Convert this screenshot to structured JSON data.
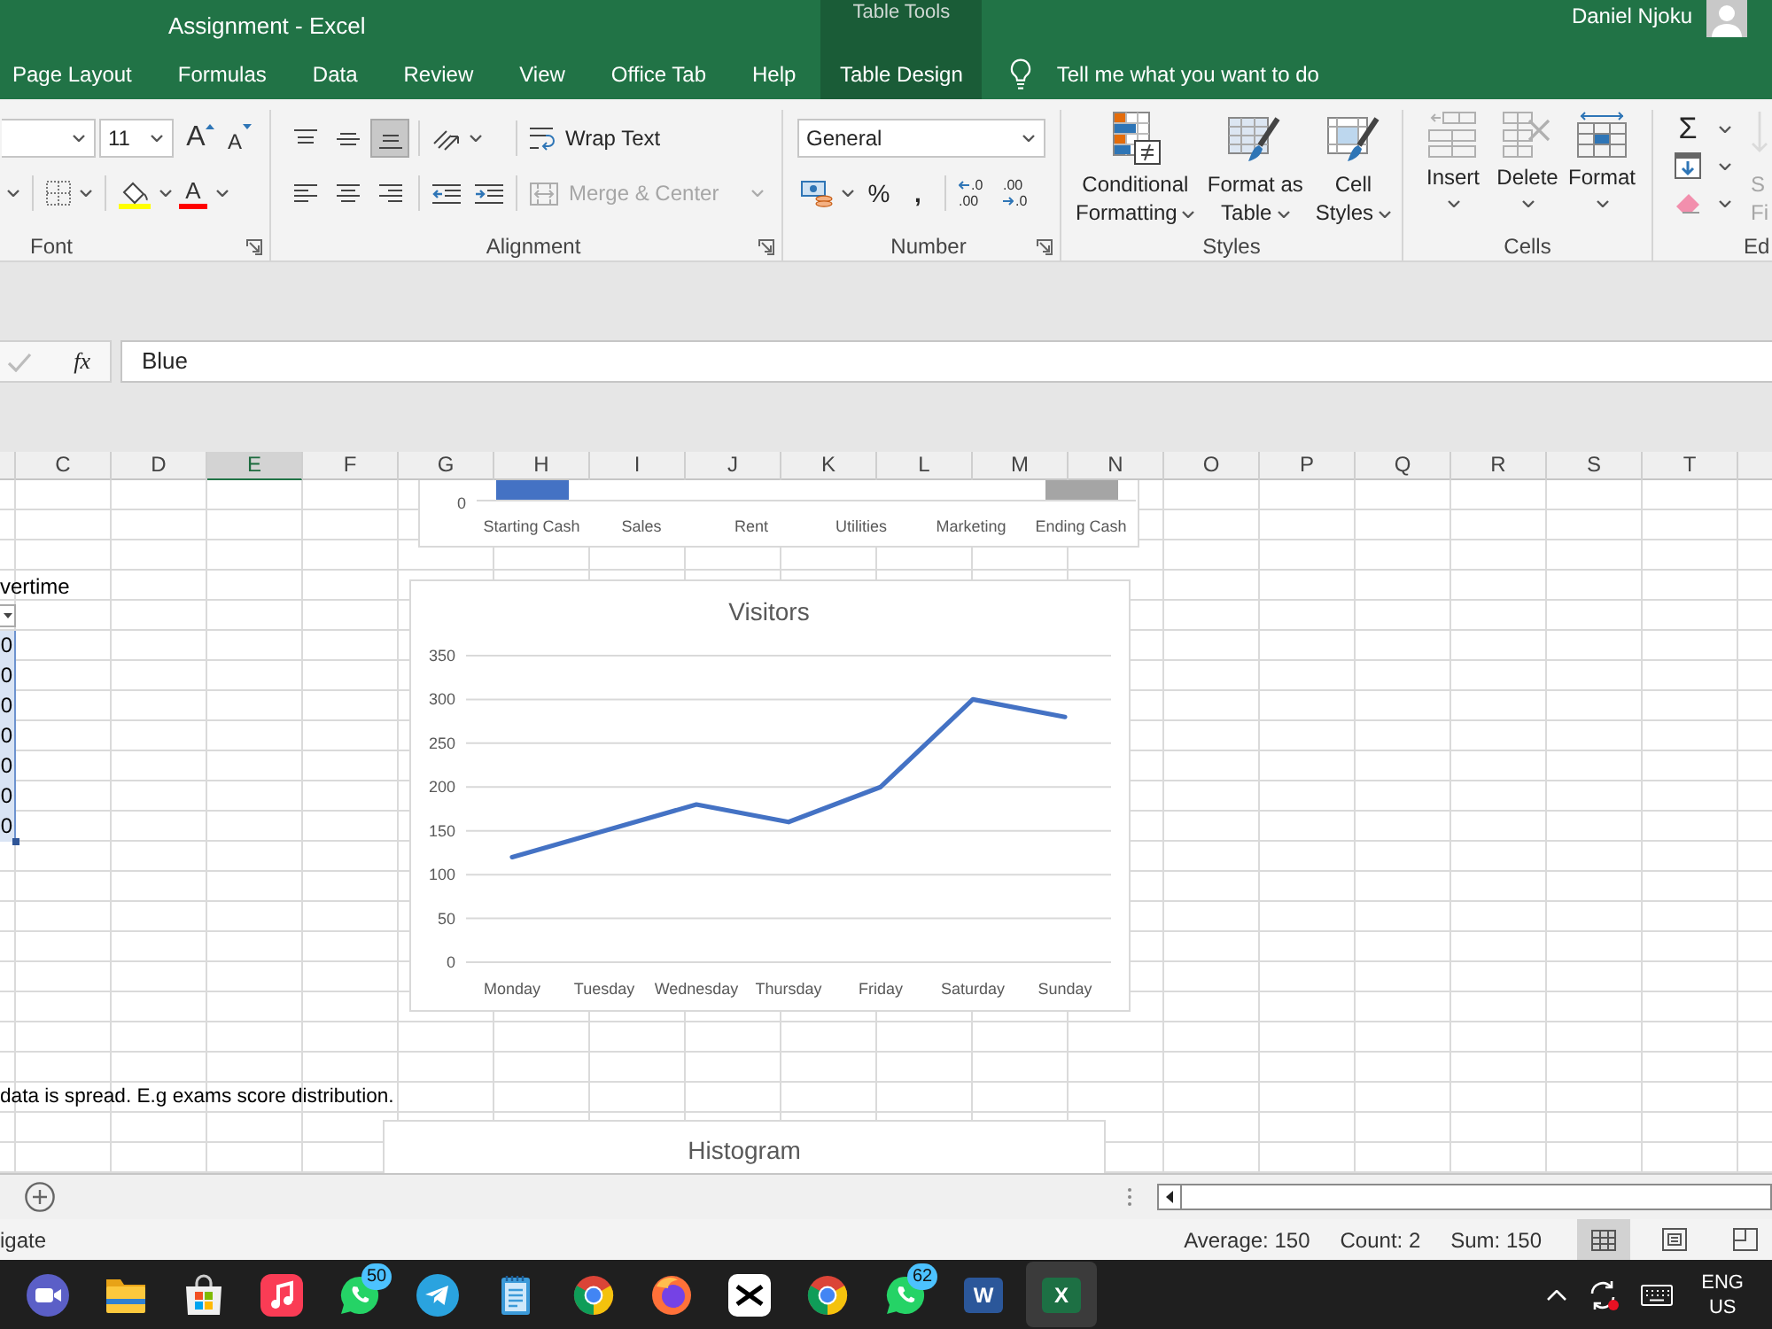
{
  "window": {
    "title": "Assignment - Excel",
    "tool_group": "Table Tools",
    "user": "Daniel Njoku"
  },
  "tabs": [
    {
      "label": "Page Layout",
      "kind": "standard",
      "selected": false
    },
    {
      "label": "Formulas",
      "kind": "standard",
      "selected": false
    },
    {
      "label": "Data",
      "kind": "standard",
      "selected": false
    },
    {
      "label": "Review",
      "kind": "standard",
      "selected": false
    },
    {
      "label": "View",
      "kind": "standard",
      "selected": false
    },
    {
      "label": "Office Tab",
      "kind": "standard",
      "selected": false
    },
    {
      "label": "Help",
      "kind": "standard",
      "selected": false
    },
    {
      "label": "Table Design",
      "kind": "contextual",
      "selected": false
    }
  ],
  "tell_me": {
    "label": "Tell me what you want to do"
  },
  "ribbon": {
    "font": {
      "label": "Font",
      "launcher": true,
      "size": "11",
      "grow_glyph": "A",
      "shrink_glyph": "A",
      "color_glyph": "A"
    },
    "alignment": {
      "label": "Alignment",
      "launcher": true,
      "vertical": [
        {
          "selected": false
        },
        {
          "selected": false
        },
        {
          "selected": true
        }
      ],
      "horizontal": [
        {
          "selected": false
        },
        {
          "selected": false
        },
        {
          "selected": false
        }
      ],
      "wrap_text": {
        "label": "Wrap Text",
        "disabled": false
      },
      "merge": {
        "label": "Merge & Center",
        "disabled": true
      }
    },
    "number": {
      "label": "Number",
      "launcher": true,
      "format": "General",
      "percent": "%",
      "comma": ",",
      "decimals": [
        {
          "top": ".0",
          "bottom": ".00"
        },
        {
          "top": ".00",
          "bottom": ".0"
        }
      ]
    },
    "styles": {
      "label": "Styles",
      "buttons": [
        {
          "label": "Conditional\nFormatting"
        },
        {
          "label": "Format as\nTable"
        },
        {
          "label": "Cell\nStyles"
        }
      ]
    },
    "cells": {
      "label": "Cells",
      "buttons": [
        {
          "label": "Insert"
        },
        {
          "label": "Delete"
        },
        {
          "label": "Format"
        }
      ]
    },
    "editing": {
      "label": "Ed",
      "sum_glyph": "Σ",
      "sort_filter": {
        "label": "S\nFi",
        "disabled": true
      }
    }
  },
  "formula_bar": {
    "function_label": "fx",
    "value": "Blue"
  },
  "columns": [
    {
      "label": "C",
      "selected": false
    },
    {
      "label": "D",
      "selected": false
    },
    {
      "label": "E",
      "selected": true
    },
    {
      "label": "F",
      "selected": false
    },
    {
      "label": "G",
      "selected": false
    },
    {
      "label": "H",
      "selected": false
    },
    {
      "label": "I",
      "selected": false
    },
    {
      "label": "J",
      "selected": false
    },
    {
      "label": "K",
      "selected": false
    },
    {
      "label": "L",
      "selected": false
    },
    {
      "label": "M",
      "selected": false
    },
    {
      "label": "N",
      "selected": false
    },
    {
      "label": "O",
      "selected": false
    },
    {
      "label": "P",
      "selected": false
    },
    {
      "label": "Q",
      "selected": false
    },
    {
      "label": "R",
      "selected": false
    },
    {
      "label": "S",
      "selected": false
    },
    {
      "label": "T",
      "selected": false
    }
  ],
  "sheet": {
    "header_text": "vertime",
    "values": [
      {
        "text": "0",
        "selected": true
      },
      {
        "text": "0",
        "selected": true
      },
      {
        "text": "0",
        "selected": true
      },
      {
        "text": "0",
        "selected": true
      },
      {
        "text": "0",
        "selected": true
      },
      {
        "text": "0",
        "selected": true
      },
      {
        "text": "0",
        "selected": true
      }
    ],
    "note": "data is spread. E.g exams score distribution."
  },
  "charts": [
    {
      "kind": "waterfall",
      "axis_label": "0",
      "categories": [
        {
          "label": "Starting Cash",
          "color": "#4472c4"
        },
        {
          "label": "Sales"
        },
        {
          "label": "Rent"
        },
        {
          "label": "Utilities"
        },
        {
          "label": "Marketing"
        },
        {
          "label": "Ending Cash",
          "color": "#a5a5a5"
        }
      ]
    },
    {
      "kind": "line",
      "chart_data": {
        "type": "line",
        "title": "Visitors",
        "categories": [
          "Monday",
          "Tuesday",
          "Wednesday",
          "Thursday",
          "Friday",
          "Saturday",
          "Sunday"
        ],
        "series": [
          {
            "color": "#4472c4",
            "values": [
              120,
              150,
              180,
              160,
              200,
              300,
              280
            ]
          }
        ],
        "ylim": [
          0,
          350
        ],
        "yticks": [
          0,
          50,
          100,
          150,
          200,
          250,
          300,
          350
        ],
        "grid": true
      }
    },
    {
      "kind": "histogram",
      "title": "Histogram"
    }
  ],
  "status_bar": {
    "message": "igate",
    "summary": [
      "Average: 150",
      "Count: 2",
      "Sum: 150"
    ],
    "views": [
      {
        "selected": true
      },
      {
        "selected": false
      },
      {
        "selected": false
      }
    ]
  },
  "taskbar": {
    "apps": [
      {
        "selected": false
      },
      {
        "selected": false
      },
      {
        "selected": false
      },
      {
        "selected": false
      },
      {
        "selected": false,
        "badge": "50"
      },
      {
        "selected": false
      },
      {
        "selected": false
      },
      {
        "selected": false
      },
      {
        "selected": false
      },
      {
        "selected": false
      },
      {
        "selected": false
      },
      {
        "selected": false,
        "badge": "62"
      },
      {
        "selected": false,
        "glyph": "W"
      },
      {
        "selected": true,
        "glyph": "X"
      }
    ],
    "tray": {
      "language": "ENG",
      "region": "US"
    }
  }
}
